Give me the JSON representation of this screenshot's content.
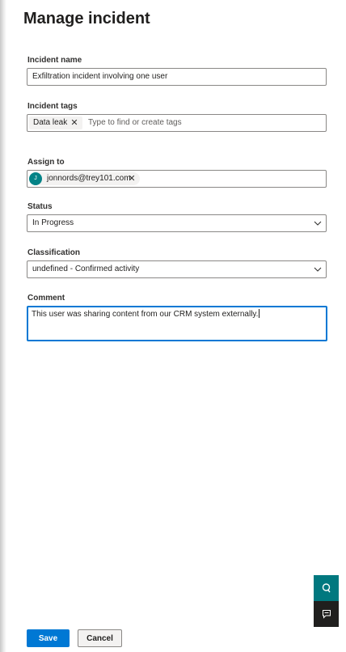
{
  "panel": {
    "title": "Manage incident"
  },
  "incident_name": {
    "label": "Incident name",
    "value": "Exfiltration incident involving one user"
  },
  "incident_tags": {
    "label": "Incident tags",
    "tags": [
      {
        "label": "Data leak"
      }
    ],
    "placeholder": "Type to find or create tags"
  },
  "assign_to": {
    "label": "Assign to",
    "person": {
      "initial": "J",
      "email": "jonnords@trey101.com"
    }
  },
  "status": {
    "label": "Status",
    "selected": "In Progress"
  },
  "classification": {
    "label": "Classification",
    "selected": "undefined - Confirmed activity"
  },
  "comment": {
    "label": "Comment",
    "value": "This user was sharing content from our CRM system externally."
  },
  "side_actions": {
    "items": [
      {
        "icon": "help-icon"
      },
      {
        "icon": "feedback-icon"
      }
    ],
    "colors": {
      "help_bg": "#00787f",
      "feedback_bg": "#201f1e"
    }
  },
  "footer": {
    "save_label": "Save",
    "cancel_label": "Cancel"
  },
  "colors": {
    "accent": "#0078d4",
    "avatar": "#038387"
  }
}
